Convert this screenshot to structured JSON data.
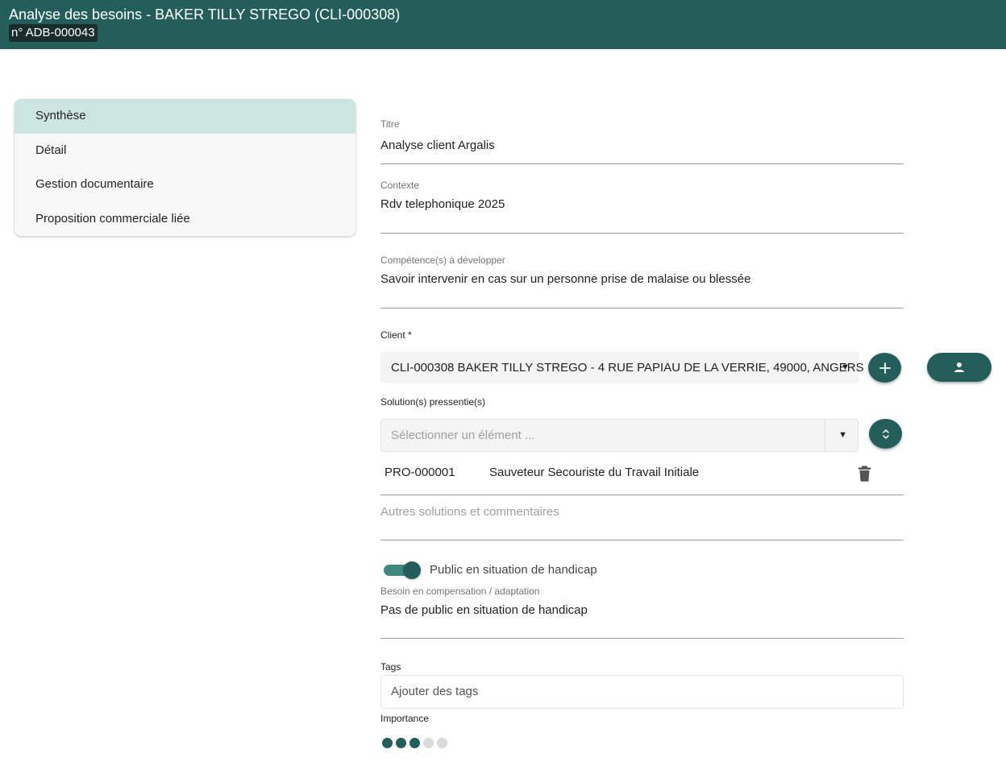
{
  "header": {
    "title": "Analyse des besoins - BAKER TILLY STREGO (CLI-000308)",
    "badge": "n° ADB-000043"
  },
  "nav": {
    "items": [
      {
        "label": "Synthèse",
        "active": true
      },
      {
        "label": "Détail",
        "active": false
      },
      {
        "label": "Gestion documentaire",
        "active": false
      },
      {
        "label": "Proposition commerciale liée",
        "active": false
      }
    ]
  },
  "form": {
    "titre": {
      "label": "Titre",
      "value": "Analyse client Argalis"
    },
    "contexte": {
      "label": "Contexte",
      "value": "Rdv telephonique 2025"
    },
    "competences": {
      "label": "Compétence(s) à développer",
      "value": "Savoir intervenir en cas sur un personne prise de malaise ou blessée"
    },
    "client": {
      "label": "Client *",
      "value": "CLI-000308 BAKER TILLY STREGO - 4 RUE PAPIAU DE LA VERRIE, 49000, ANGERS"
    },
    "solutions": {
      "label": "Solution(s) pressentie(s)",
      "placeholder": "Sélectionner un élément ...",
      "items": [
        {
          "code": "PRO-000001",
          "name": "Sauveteur Secouriste du Travail Initiale"
        }
      ]
    },
    "autres": {
      "placeholder": "Autres solutions et commentaires"
    },
    "handicap": {
      "label": "Public en situation de handicap",
      "checked": true
    },
    "compensation": {
      "label": "Besoin en compensation / adaptation",
      "value": "Pas de public en situation de handicap"
    },
    "tags": {
      "label": "Tags",
      "placeholder": "Ajouter des tags"
    },
    "importance": {
      "label": "Importance",
      "value": 3,
      "max": 5
    }
  },
  "colors": {
    "primary": "#245e5b",
    "nav_active": "#cde5e1",
    "badge_bg": "#1a2d2c"
  },
  "icons": {
    "add": "plus-icon",
    "contact": "person-icon",
    "expand": "unfold-icon",
    "delete": "trash-icon",
    "dropdown": "caret-down-icon"
  }
}
